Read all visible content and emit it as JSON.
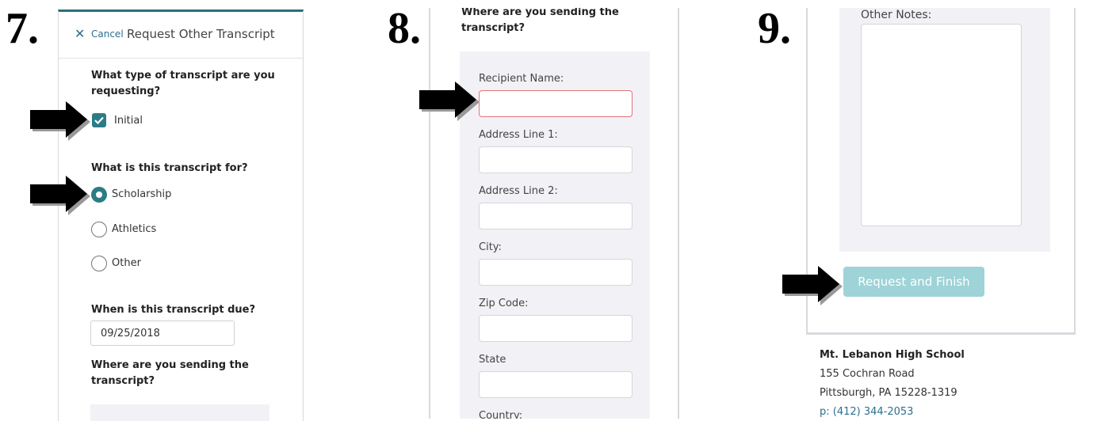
{
  "steps": {
    "s7": "7.",
    "s8": "8.",
    "s9": "9."
  },
  "panel7": {
    "cancel_label": "Cancel",
    "title": "Request Other Transcript",
    "q_type": "What type of transcript are you requesting?",
    "type_option": "Initial",
    "type_checked": true,
    "q_for": "What is this transcript for?",
    "for_options": [
      "Scholarship",
      "Athletics",
      "Other"
    ],
    "for_selected": "Scholarship",
    "q_due": "When is this transcript due?",
    "due_value": "09/25/2018",
    "q_send": "Where are you sending the transcript?"
  },
  "panel8": {
    "q_send": "Where are you sending the transcript?",
    "fields": [
      "Recipient Name:",
      "Address Line 1:",
      "Address Line 2:",
      "City:",
      "Zip Code:",
      "State",
      "Country:"
    ],
    "error_field": "Recipient Name:"
  },
  "panel9": {
    "notes_label": "Other Notes:",
    "submit_label": "Request and Finish"
  },
  "school": {
    "name": "Mt. Lebanon High School",
    "street": "155 Cochran Road",
    "city": "Pittsburgh, PA 15228-1319",
    "phone": "p: (412) 344-2053"
  },
  "colors": {
    "accent": "#2b7c86",
    "link": "#2b6f8f",
    "error_border": "#e07474",
    "disabled_button": "#9ed3d8"
  },
  "icons": {
    "cancel": "close-icon",
    "check": "check-icon",
    "pointer": "arrow-right-icon"
  }
}
